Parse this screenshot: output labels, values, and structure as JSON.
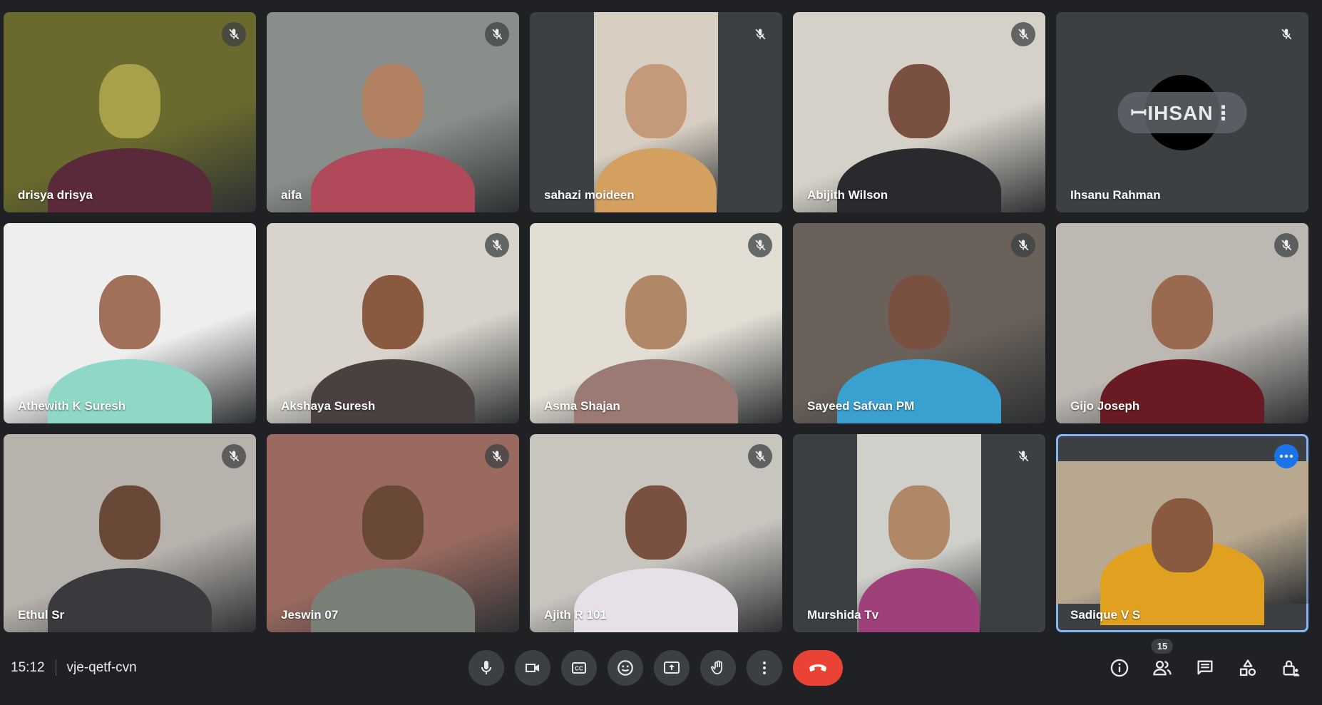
{
  "meeting": {
    "time": "15:12",
    "code": "vje-qetf-cvn"
  },
  "participants": [
    {
      "name": "drisya drisya",
      "muted": true,
      "bg": "#6a6a2e",
      "skin": "#a8a04a",
      "cloth": "#5a2a3a"
    },
    {
      "name": "aifa",
      "muted": true,
      "bg": "#8a8e8a",
      "skin": "#b08060",
      "cloth": "#b04a5a"
    },
    {
      "name": "sahazi moideen",
      "muted": true,
      "bg": "#d8cfc2",
      "skin": "#c49a7a",
      "cloth": "#d4a060",
      "narrow": true
    },
    {
      "name": "Abijith Wilson",
      "muted": true,
      "bg": "#d6d1c8",
      "skin": "#7a5040",
      "cloth": "#2a2a2e"
    },
    {
      "name": "Ihsanu Rahman",
      "muted": true,
      "avatar": true,
      "avatar_text": "ꟷIHSAN⋮"
    },
    {
      "name": "Athewith K Suresh",
      "muted": false,
      "bg": "#eeeeee",
      "skin": "#a07058",
      "cloth": "#8fd8c8"
    },
    {
      "name": "Akshaya Suresh",
      "muted": true,
      "bg": "#d8d4cc",
      "skin": "#8a5a40",
      "cloth": "#4a4040"
    },
    {
      "name": "Asma Shajan",
      "muted": true,
      "bg": "#e2ded4",
      "skin": "#b08868",
      "cloth": "#9a7a72"
    },
    {
      "name": "Sayeed Safvan PM",
      "muted": true,
      "bg": "#6a625a",
      "skin": "#7a5040",
      "cloth": "#3aa0d0"
    },
    {
      "name": "Gijo Joseph",
      "muted": true,
      "bg": "#bdb8b2",
      "skin": "#9a6a50",
      "cloth": "#6a1a22"
    },
    {
      "name": "Ethul Sr",
      "muted": true,
      "bg": "#b8b2ac",
      "skin": "#6a4838",
      "cloth": "#3a3a3e"
    },
    {
      "name": "Jeswin 07",
      "muted": true,
      "bg": "#9a6a60",
      "skin": "#6a4838",
      "cloth": "#7a8078"
    },
    {
      "name": "Ajith R 101",
      "muted": true,
      "bg": "#c8c4be",
      "skin": "#7a5040",
      "cloth": "#e8e0e8"
    },
    {
      "name": "Murshida Tv",
      "muted": true,
      "bg": "#cfd0ca",
      "skin": "#b08868",
      "cloth": "#a0407a",
      "narrow": true
    },
    {
      "name": "Sadique V S",
      "muted": false,
      "bg": "#b8a890",
      "skin": "#8a5a40",
      "cloth": "#e0a020",
      "active": true
    }
  ],
  "controls": {
    "mic": "microphone-icon",
    "camera": "camera-icon",
    "captions": "captions-icon",
    "emoji": "emoji-icon",
    "present": "present-screen-icon",
    "hand": "raise-hand-icon",
    "more": "more-options-icon",
    "end": "end-call-icon"
  },
  "side": {
    "people_count": "15"
  },
  "colors": {
    "background": "#202124",
    "tile": "#3c4043",
    "end_call": "#ea4335",
    "active_border": "#8ab4f8",
    "accent": "#1a73e8"
  }
}
